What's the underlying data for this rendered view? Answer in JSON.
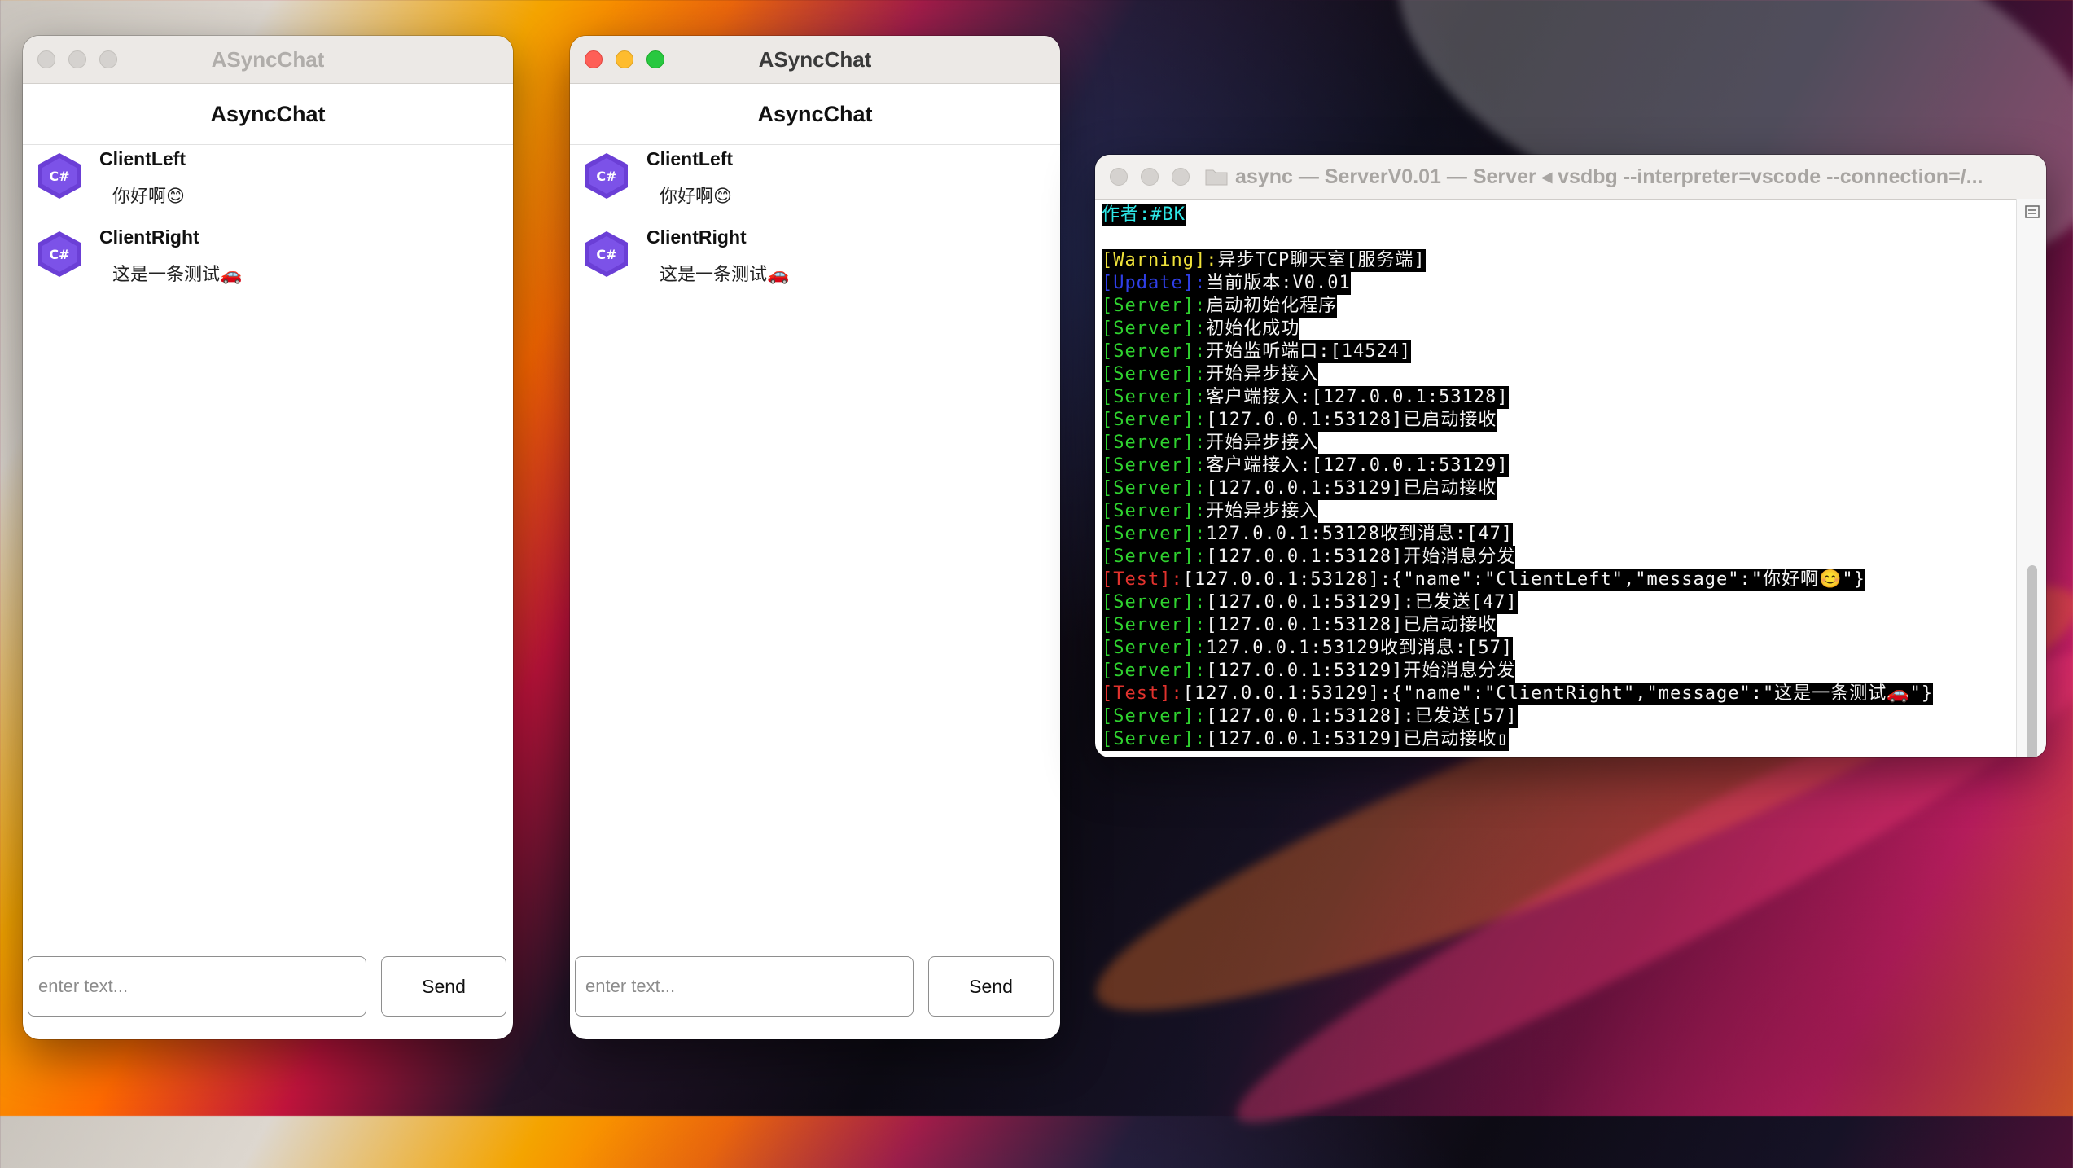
{
  "desktop": {
    "background": "macOS wallpaper"
  },
  "chat_windows": [
    {
      "id": "left",
      "window_title": "ASyncChat",
      "active": false,
      "app_title": "AsyncChat",
      "messages": [
        {
          "sender": "ClientLeft",
          "text": "你好啊😊",
          "avatar": "csharp-logo"
        },
        {
          "sender": "ClientRight",
          "text": "这是一条测试🚗",
          "avatar": "csharp-logo"
        }
      ],
      "input": {
        "value": "",
        "placeholder": "enter text..."
      },
      "send_label": "Send"
    },
    {
      "id": "right",
      "window_title": "ASyncChat",
      "active": true,
      "app_title": "AsyncChat",
      "messages": [
        {
          "sender": "ClientLeft",
          "text": "你好啊😊",
          "avatar": "csharp-logo"
        },
        {
          "sender": "ClientRight",
          "text": "这是一条测试🚗",
          "avatar": "csharp-logo"
        }
      ],
      "input": {
        "value": "",
        "placeholder": "enter text..."
      },
      "send_label": "Send"
    }
  ],
  "terminal": {
    "title": "async — ServerV0.01 — Server ◂ vsdbg --interpreter=vscode --connection=/...",
    "colors": {
      "background": "#000000",
      "cyan": "#2ee6e6",
      "yellow": "#f0e23a",
      "blue": "#2f3fe8",
      "green": "#2fd22f",
      "red": "#e0322d",
      "text": "#f4f4f4"
    },
    "lines": [
      {
        "tag": "",
        "tag_color": "",
        "text": "作者:#BK",
        "text_color": "cyan"
      },
      {
        "tag": "",
        "tag_color": "",
        "text": "",
        "text_color": "white"
      },
      {
        "tag": "[Warning]:",
        "tag_color": "yellow",
        "text": "异步TCP聊天室[服务端]",
        "text_color": "white"
      },
      {
        "tag": "[Update]:",
        "tag_color": "blue",
        "text": "当前版本:V0.01",
        "text_color": "white"
      },
      {
        "tag": "[Server]:",
        "tag_color": "green",
        "text": "启动初始化程序",
        "text_color": "white"
      },
      {
        "tag": "[Server]:",
        "tag_color": "green",
        "text": "初始化成功",
        "text_color": "white"
      },
      {
        "tag": "[Server]:",
        "tag_color": "green",
        "text": "开始监听端口:[14524]",
        "text_color": "white"
      },
      {
        "tag": "[Server]:",
        "tag_color": "green",
        "text": "开始异步接入",
        "text_color": "white"
      },
      {
        "tag": "[Server]:",
        "tag_color": "green",
        "text": "客户端接入:[127.0.0.1:53128]",
        "text_color": "white"
      },
      {
        "tag": "[Server]:",
        "tag_color": "green",
        "text": "[127.0.0.1:53128]已启动接收",
        "text_color": "white"
      },
      {
        "tag": "[Server]:",
        "tag_color": "green",
        "text": "开始异步接入",
        "text_color": "white"
      },
      {
        "tag": "[Server]:",
        "tag_color": "green",
        "text": "客户端接入:[127.0.0.1:53129]",
        "text_color": "white"
      },
      {
        "tag": "[Server]:",
        "tag_color": "green",
        "text": "[127.0.0.1:53129]已启动接收",
        "text_color": "white"
      },
      {
        "tag": "[Server]:",
        "tag_color": "green",
        "text": "开始异步接入",
        "text_color": "white"
      },
      {
        "tag": "[Server]:",
        "tag_color": "green",
        "text": "127.0.0.1:53128收到消息:[47]",
        "text_color": "white"
      },
      {
        "tag": "[Server]:",
        "tag_color": "green",
        "text": "[127.0.0.1:53128]开始消息分发",
        "text_color": "white"
      },
      {
        "tag": "[Test]:",
        "tag_color": "red",
        "text": "[127.0.0.1:53128]:{\"name\":\"ClientLeft\",\"message\":\"你好啊😊\"}",
        "text_color": "white"
      },
      {
        "tag": "[Server]:",
        "tag_color": "green",
        "text": "[127.0.0.1:53129]:已发送[47]",
        "text_color": "white"
      },
      {
        "tag": "[Server]:",
        "tag_color": "green",
        "text": "[127.0.0.1:53128]已启动接收",
        "text_color": "white"
      },
      {
        "tag": "[Server]:",
        "tag_color": "green",
        "text": "127.0.0.1:53129收到消息:[57]",
        "text_color": "white"
      },
      {
        "tag": "[Server]:",
        "tag_color": "green",
        "text": "[127.0.0.1:53129]开始消息分发",
        "text_color": "white"
      },
      {
        "tag": "[Test]:",
        "tag_color": "red",
        "text": "[127.0.0.1:53129]:{\"name\":\"ClientRight\",\"message\":\"这是一条测试🚗\"}",
        "text_color": "white"
      },
      {
        "tag": "[Server]:",
        "tag_color": "green",
        "text": "[127.0.0.1:53128]:已发送[57]",
        "text_color": "white"
      },
      {
        "tag": "[Server]:",
        "tag_color": "green",
        "text": "[127.0.0.1:53129]已启动接收▯",
        "text_color": "white"
      }
    ]
  }
}
